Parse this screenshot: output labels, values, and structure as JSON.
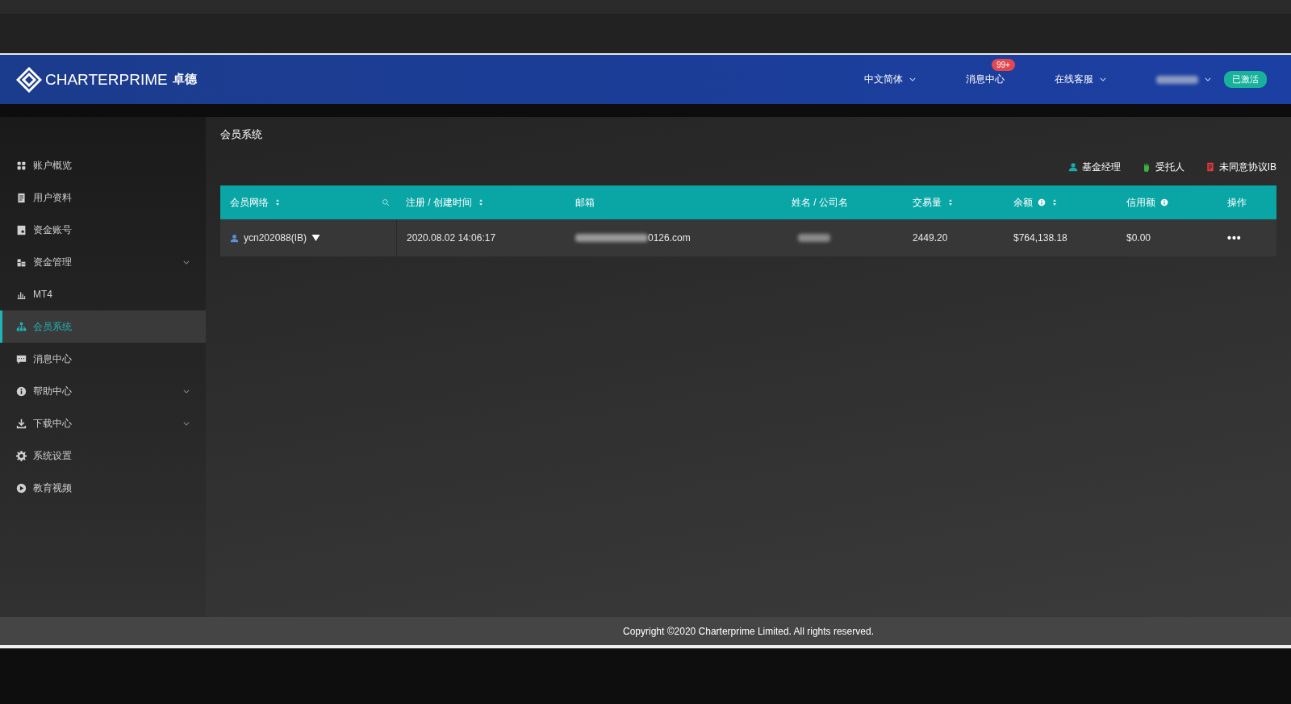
{
  "header": {
    "logo": "CHARTERPRIME",
    "logo_cn": "卓德",
    "nav": [
      {
        "label": "中文简体",
        "dropdown": true
      },
      {
        "label": "消息中心",
        "dropdown": false,
        "badge": "99+"
      },
      {
        "label": "在线客服",
        "dropdown": true
      }
    ],
    "user_redacted": true,
    "status_badge": "已激活"
  },
  "sidebar": {
    "items": [
      {
        "label": "账户概览",
        "expandable": false,
        "selected": false
      },
      {
        "label": "用户资料",
        "expandable": false,
        "selected": false
      },
      {
        "label": "资金账号",
        "expandable": false,
        "selected": false
      },
      {
        "label": "资金管理",
        "expandable": true,
        "selected": false
      },
      {
        "label": "MT4",
        "expandable": false,
        "selected": false
      },
      {
        "label": "会员系统",
        "expandable": false,
        "selected": true
      },
      {
        "label": "消息中心",
        "expandable": false,
        "selected": false
      },
      {
        "label": "帮助中心",
        "expandable": true,
        "selected": false
      },
      {
        "label": "下载中心",
        "expandable": true,
        "selected": false
      },
      {
        "label": "系统设置",
        "expandable": false,
        "selected": false
      },
      {
        "label": "教育视频",
        "expandable": false,
        "selected": false
      }
    ]
  },
  "page_title": "会员系统",
  "legend": [
    {
      "label": "基金经理",
      "color": "#1fa8a8"
    },
    {
      "label": "受托人",
      "color": "#3cb043"
    },
    {
      "label": "未同意协议IB",
      "color": "#e0383e"
    }
  ],
  "table": {
    "columns": [
      {
        "label": "会员网络",
        "sortable": true,
        "info": false,
        "search": true
      },
      {
        "label": "注册 / 创建时间",
        "sortable": true,
        "info": false,
        "search": false
      },
      {
        "label": "邮箱",
        "sortable": false,
        "info": false,
        "search": false
      },
      {
        "label": "姓名 / 公司名",
        "sortable": false,
        "info": false,
        "search": false
      },
      {
        "label": "交易量",
        "sortable": true,
        "info": false,
        "search": false
      },
      {
        "label": "余额",
        "sortable": true,
        "info": true,
        "search": false
      },
      {
        "label": "信用额",
        "sortable": false,
        "info": true,
        "search": false
      },
      {
        "label": "操作",
        "sortable": false,
        "info": false,
        "search": false
      }
    ],
    "rows": [
      {
        "member": "ycn202088(IB)",
        "expanded": false,
        "created": "2020.08.02 14:06:17",
        "email": "0126.com",
        "email_redacted": true,
        "name_redacted": true,
        "volume": "2449.20",
        "balance": "$764,138.18",
        "credit": "$0.00",
        "actions": "•••"
      }
    ]
  },
  "footer": {
    "copyright": "Copyright ©2020 Charterprime Limited. All rights reserved."
  }
}
